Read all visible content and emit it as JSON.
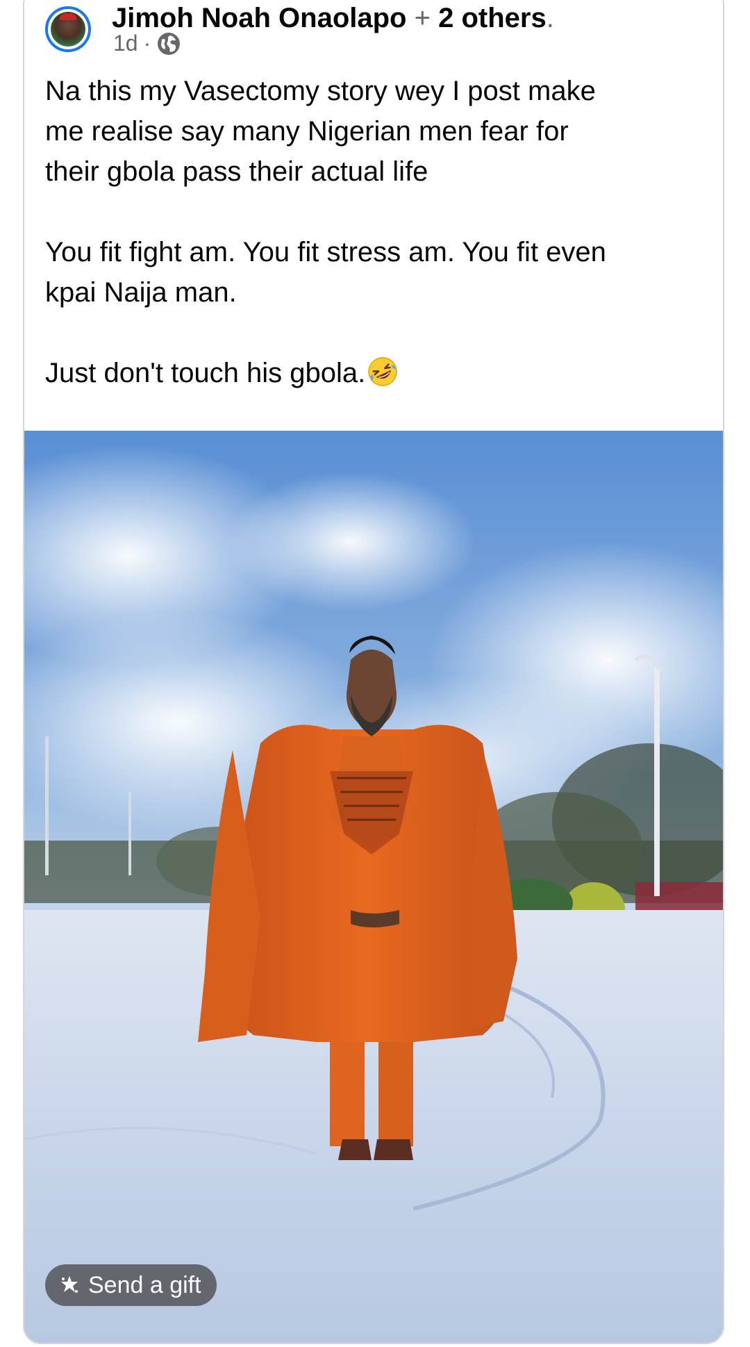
{
  "post": {
    "author": "Jimoh Noah Onaolapo",
    "plus_sign": "+",
    "others": "2 others",
    "trailing_dot": ".",
    "timestamp": "1d",
    "separator": "·",
    "privacy_icon": "globe-icon",
    "text": {
      "line1": "Na this my Vasectomy story wey I post make",
      "line2": "me realise say many Nigerian men fear for",
      "line3": "their gbola pass their actual life",
      "line4": "You fit fight am. You fit stress am. You fit even",
      "line5": "kpai Naija man.",
      "line6": "Just don't touch his gbola.",
      "emoji": "rolling-on-floor-laughing-emoji"
    },
    "photo_alt": "Man in orange agbada standing on snowy road",
    "gift_button": {
      "label": "Send a gift",
      "icon": "gift-icon"
    }
  },
  "colors": {
    "accent": "#1877f2",
    "text": "#050505",
    "muted": "#65676b",
    "agbada": "#e4631c"
  }
}
